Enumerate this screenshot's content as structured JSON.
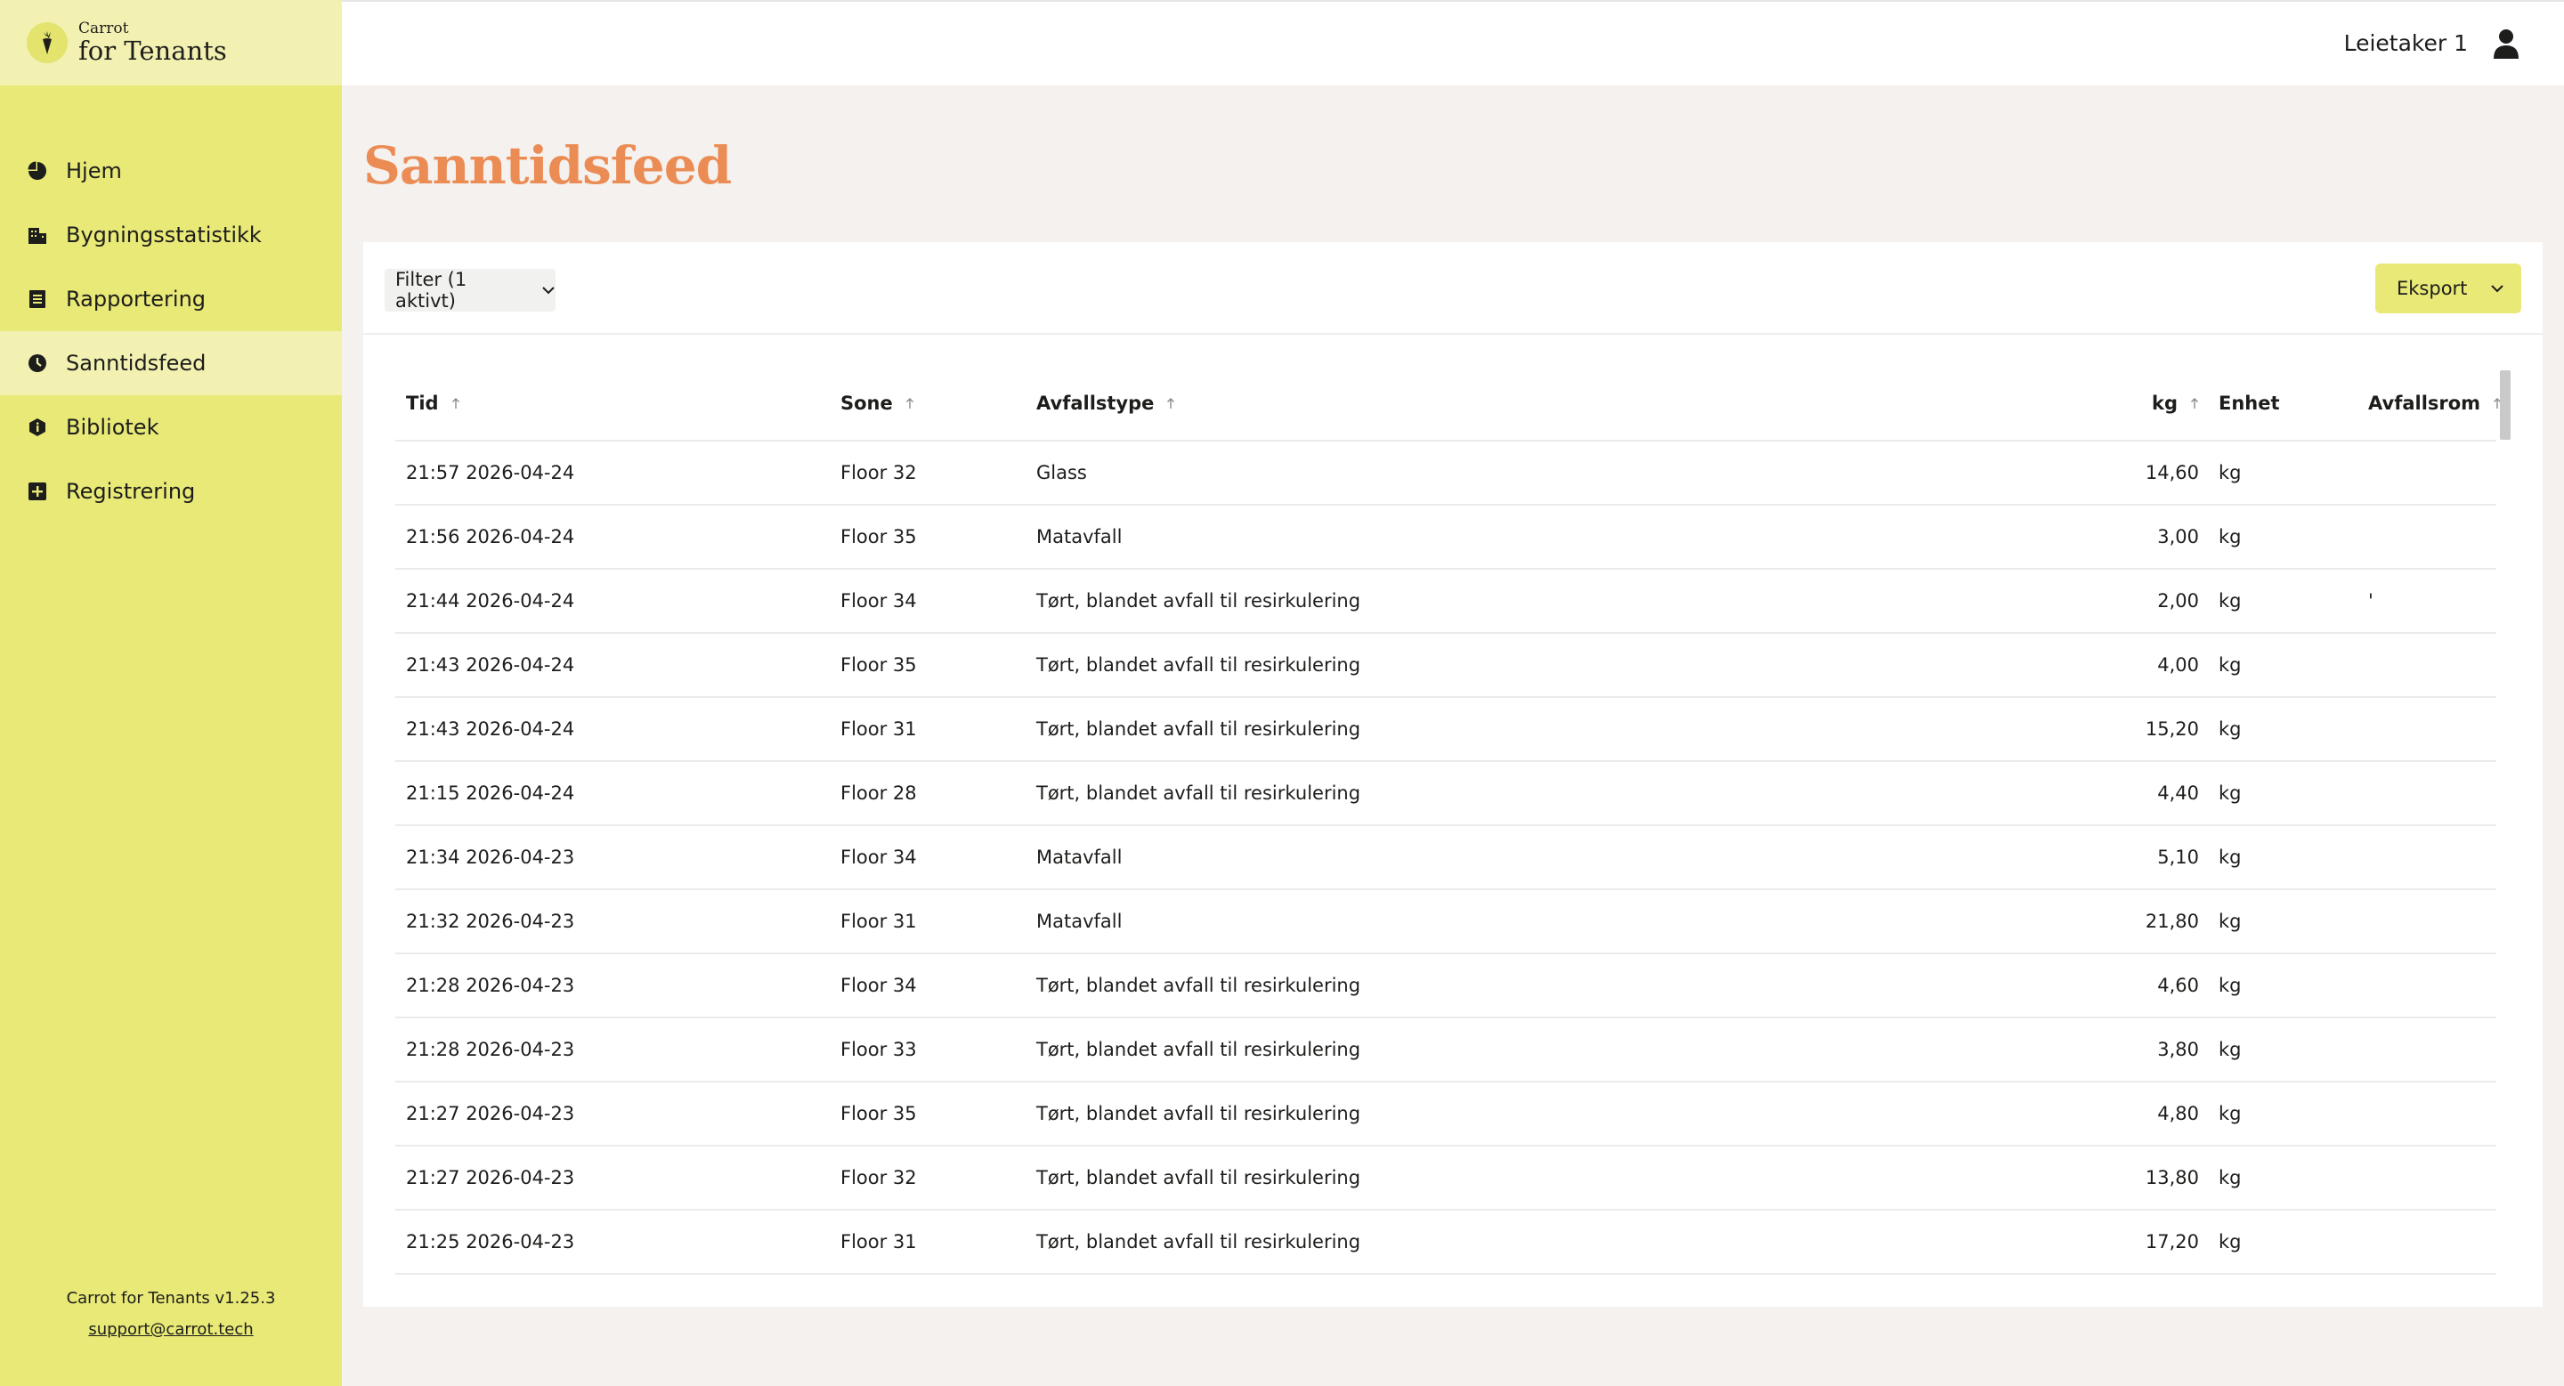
{
  "brand": {
    "small": "Carrot",
    "big": "for Tenants",
    "logo_icon": "carrot-icon",
    "accent": "#e8e977",
    "accent_light": "#f2f1b2",
    "title_color": "#ec8c55"
  },
  "sidebar": {
    "items": [
      {
        "label": "Hjem",
        "icon": "pie-chart-icon",
        "active": false
      },
      {
        "label": "Bygningsstatistikk",
        "icon": "building-icon",
        "active": false
      },
      {
        "label": "Rapportering",
        "icon": "report-icon",
        "active": false
      },
      {
        "label": "Sanntidsfeed",
        "icon": "clock-icon",
        "active": true
      },
      {
        "label": "Bibliotek",
        "icon": "info-icon",
        "active": false
      },
      {
        "label": "Registrering",
        "icon": "plus-square-icon",
        "active": false
      }
    ],
    "version": "Carrot for Tenants v1.25.3",
    "support_email": "support@carrot.tech"
  },
  "topbar": {
    "user_name": "Leietaker 1",
    "user_icon": "user-icon"
  },
  "page": {
    "title": "Sanntidsfeed"
  },
  "toolbar": {
    "filter_label": "Filter (1 aktivt)",
    "export_label": "Eksport"
  },
  "table": {
    "headers": {
      "tid": "Tid",
      "sone": "Sone",
      "avfallstype": "Avfallstype",
      "kg": "kg",
      "enhet": "Enhet",
      "avfallsrom": "Avfallsrom"
    },
    "rows": [
      {
        "tid": "21:57 2026-04-24",
        "sone": "Floor 32",
        "type": "Glass",
        "kg": "14,60",
        "enhet": "kg",
        "rom": ""
      },
      {
        "tid": "21:56 2026-04-24",
        "sone": "Floor 35",
        "type": "Matavfall",
        "kg": "3,00",
        "enhet": "kg",
        "rom": ""
      },
      {
        "tid": "21:44 2026-04-24",
        "sone": "Floor 34",
        "type": "Tørt, blandet avfall til resirkulering",
        "kg": "2,00",
        "enhet": "kg",
        "rom": "'"
      },
      {
        "tid": "21:43 2026-04-24",
        "sone": "Floor 35",
        "type": "Tørt, blandet avfall til resirkulering",
        "kg": "4,00",
        "enhet": "kg",
        "rom": ""
      },
      {
        "tid": "21:43 2026-04-24",
        "sone": "Floor 31",
        "type": "Tørt, blandet avfall til resirkulering",
        "kg": "15,20",
        "enhet": "kg",
        "rom": ""
      },
      {
        "tid": "21:15 2026-04-24",
        "sone": "Floor 28",
        "type": "Tørt, blandet avfall til resirkulering",
        "kg": "4,40",
        "enhet": "kg",
        "rom": ""
      },
      {
        "tid": "21:34 2026-04-23",
        "sone": "Floor 34",
        "type": "Matavfall",
        "kg": "5,10",
        "enhet": "kg",
        "rom": ""
      },
      {
        "tid": "21:32 2026-04-23",
        "sone": "Floor 31",
        "type": "Matavfall",
        "kg": "21,80",
        "enhet": "kg",
        "rom": ""
      },
      {
        "tid": "21:28 2026-04-23",
        "sone": "Floor 34",
        "type": "Tørt, blandet avfall til resirkulering",
        "kg": "4,60",
        "enhet": "kg",
        "rom": ""
      },
      {
        "tid": "21:28 2026-04-23",
        "sone": "Floor 33",
        "type": "Tørt, blandet avfall til resirkulering",
        "kg": "3,80",
        "enhet": "kg",
        "rom": ""
      },
      {
        "tid": "21:27 2026-04-23",
        "sone": "Floor 35",
        "type": "Tørt, blandet avfall til resirkulering",
        "kg": "4,80",
        "enhet": "kg",
        "rom": ""
      },
      {
        "tid": "21:27 2026-04-23",
        "sone": "Floor 32",
        "type": "Tørt, blandet avfall til resirkulering",
        "kg": "13,80",
        "enhet": "kg",
        "rom": ""
      },
      {
        "tid": "21:25 2026-04-23",
        "sone": "Floor 31",
        "type": "Tørt, blandet avfall til resirkulering",
        "kg": "17,20",
        "enhet": "kg",
        "rom": ""
      }
    ]
  }
}
